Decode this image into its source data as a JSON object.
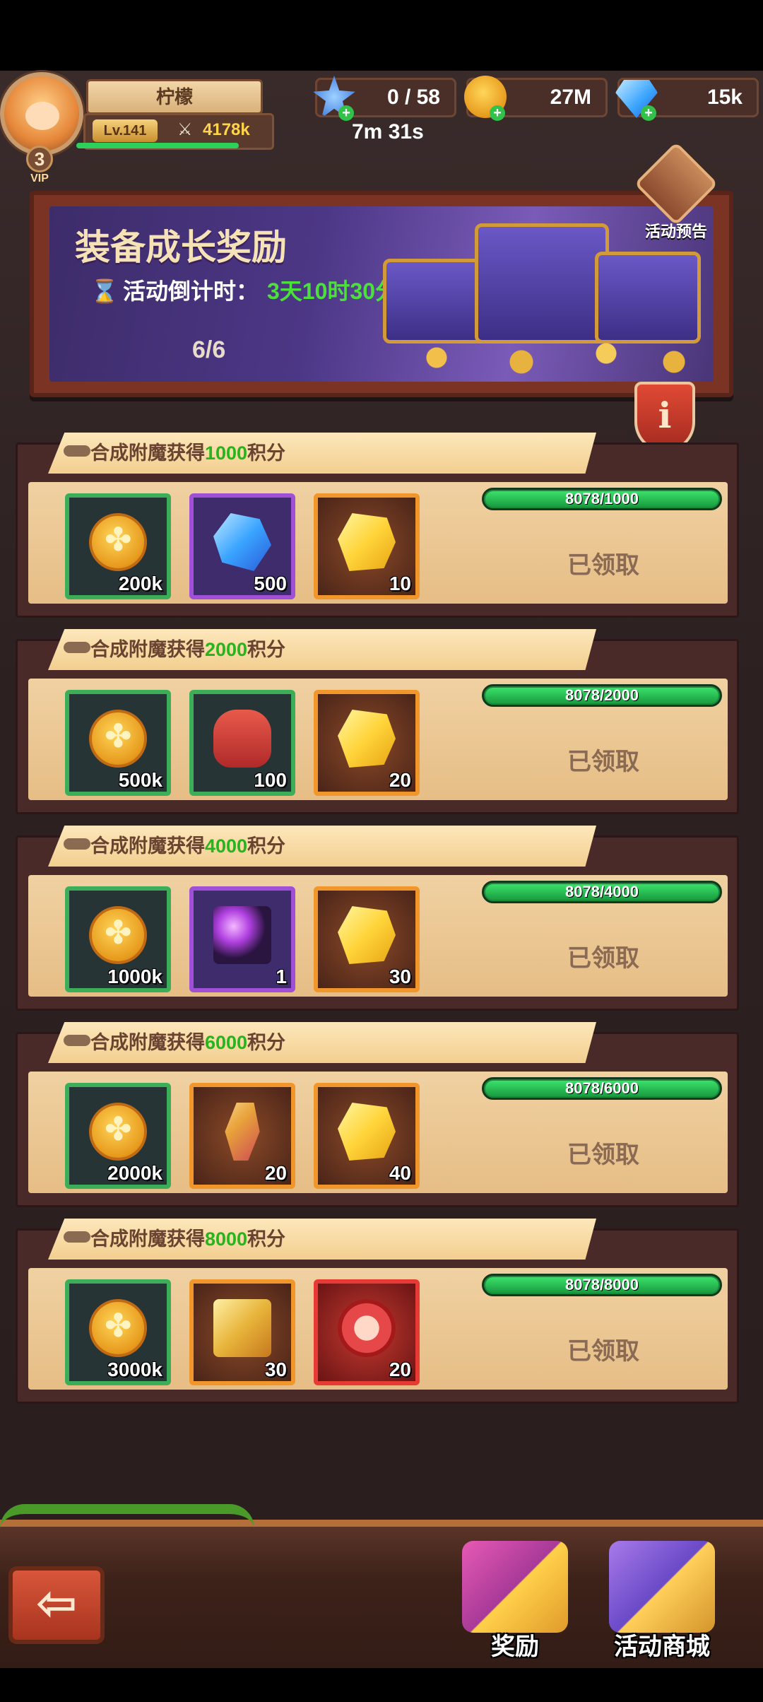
{
  "player": {
    "name": "柠檬",
    "level": "Lv.141",
    "power": "4178k",
    "vip_level": "3",
    "vip_label": "VIP",
    "xp_fraction": 0.96
  },
  "resources": {
    "stamina": "0 / 58",
    "stamina_timer": "7m 31s",
    "gold": "27M",
    "gems": "15k"
  },
  "banner": {
    "title": "装备成长奖励",
    "countdown_label": "活动倒计时：",
    "countdown_value": "3天10时30分",
    "progress": "6/6",
    "preview_label": "活动预告"
  },
  "rewards": [
    {
      "title_prefix": "合成附魔获得",
      "target": "1000",
      "title_suffix": "积分",
      "progress_text": "8078/1000",
      "progress_fraction": 1.0,
      "status": "已领取",
      "items": [
        {
          "icon": "gold-coin-icon",
          "qty": "200k",
          "rarity": "green",
          "art": "coin-art"
        },
        {
          "icon": "blue-crystal-icon",
          "qty": "500",
          "rarity": "purple",
          "art": "gem-art"
        },
        {
          "icon": "gold-ore-icon",
          "qty": "10",
          "rarity": "orange",
          "art": "gold-art"
        }
      ]
    },
    {
      "title_prefix": "合成附魔获得",
      "target": "2000",
      "title_suffix": "积分",
      "progress_text": "8078/2000",
      "progress_fraction": 1.0,
      "status": "已领取",
      "items": [
        {
          "icon": "gold-coin-icon",
          "qty": "500k",
          "rarity": "green",
          "art": "coin-art"
        },
        {
          "icon": "red-bag-icon",
          "qty": "100",
          "rarity": "green",
          "art": "bag-art"
        },
        {
          "icon": "gold-ore-icon",
          "qty": "20",
          "rarity": "orange",
          "art": "gold-art"
        }
      ]
    },
    {
      "title_prefix": "合成附魔获得",
      "target": "4000",
      "title_suffix": "积分",
      "progress_text": "8078/4000",
      "progress_fraction": 1.0,
      "status": "已领取",
      "items": [
        {
          "icon": "gold-coin-icon",
          "qty": "1000k",
          "rarity": "green",
          "art": "coin-art"
        },
        {
          "icon": "magic-staff-icon",
          "qty": "1",
          "rarity": "purple",
          "art": "staff-art"
        },
        {
          "icon": "gold-ore-icon",
          "qty": "30",
          "rarity": "orange",
          "art": "gold-art"
        }
      ]
    },
    {
      "title_prefix": "合成附魔获得",
      "target": "6000",
      "title_suffix": "积分",
      "progress_text": "8078/6000",
      "progress_fraction": 1.0,
      "status": "已领取",
      "items": [
        {
          "icon": "gold-coin-icon",
          "qty": "2000k",
          "rarity": "green",
          "art": "coin-art"
        },
        {
          "icon": "rose-scroll-icon",
          "qty": "20",
          "rarity": "orange",
          "art": "scroll-art"
        },
        {
          "icon": "gold-ore-icon",
          "qty": "40",
          "rarity": "orange",
          "art": "gold-art"
        }
      ]
    },
    {
      "title_prefix": "合成附魔获得",
      "target": "8000",
      "title_suffix": "积分",
      "progress_text": "8078/8000",
      "progress_fraction": 1.0,
      "status": "已领取",
      "items": [
        {
          "icon": "gold-coin-icon",
          "qty": "3000k",
          "rarity": "green",
          "art": "coin-art"
        },
        {
          "icon": "treasure-chest-icon",
          "qty": "30",
          "rarity": "orange",
          "art": "chest-art"
        },
        {
          "icon": "paw-token-icon",
          "qty": "20",
          "rarity": "red",
          "art": "paw-art"
        }
      ]
    }
  ],
  "nav": {
    "back": "⇦",
    "rewards_tab": "奖励",
    "shop_tab": "活动商城"
  },
  "colors": {
    "accent_green": "#28b41e",
    "parchment": "#f0d1a2",
    "card_border": "#4a2a28"
  }
}
